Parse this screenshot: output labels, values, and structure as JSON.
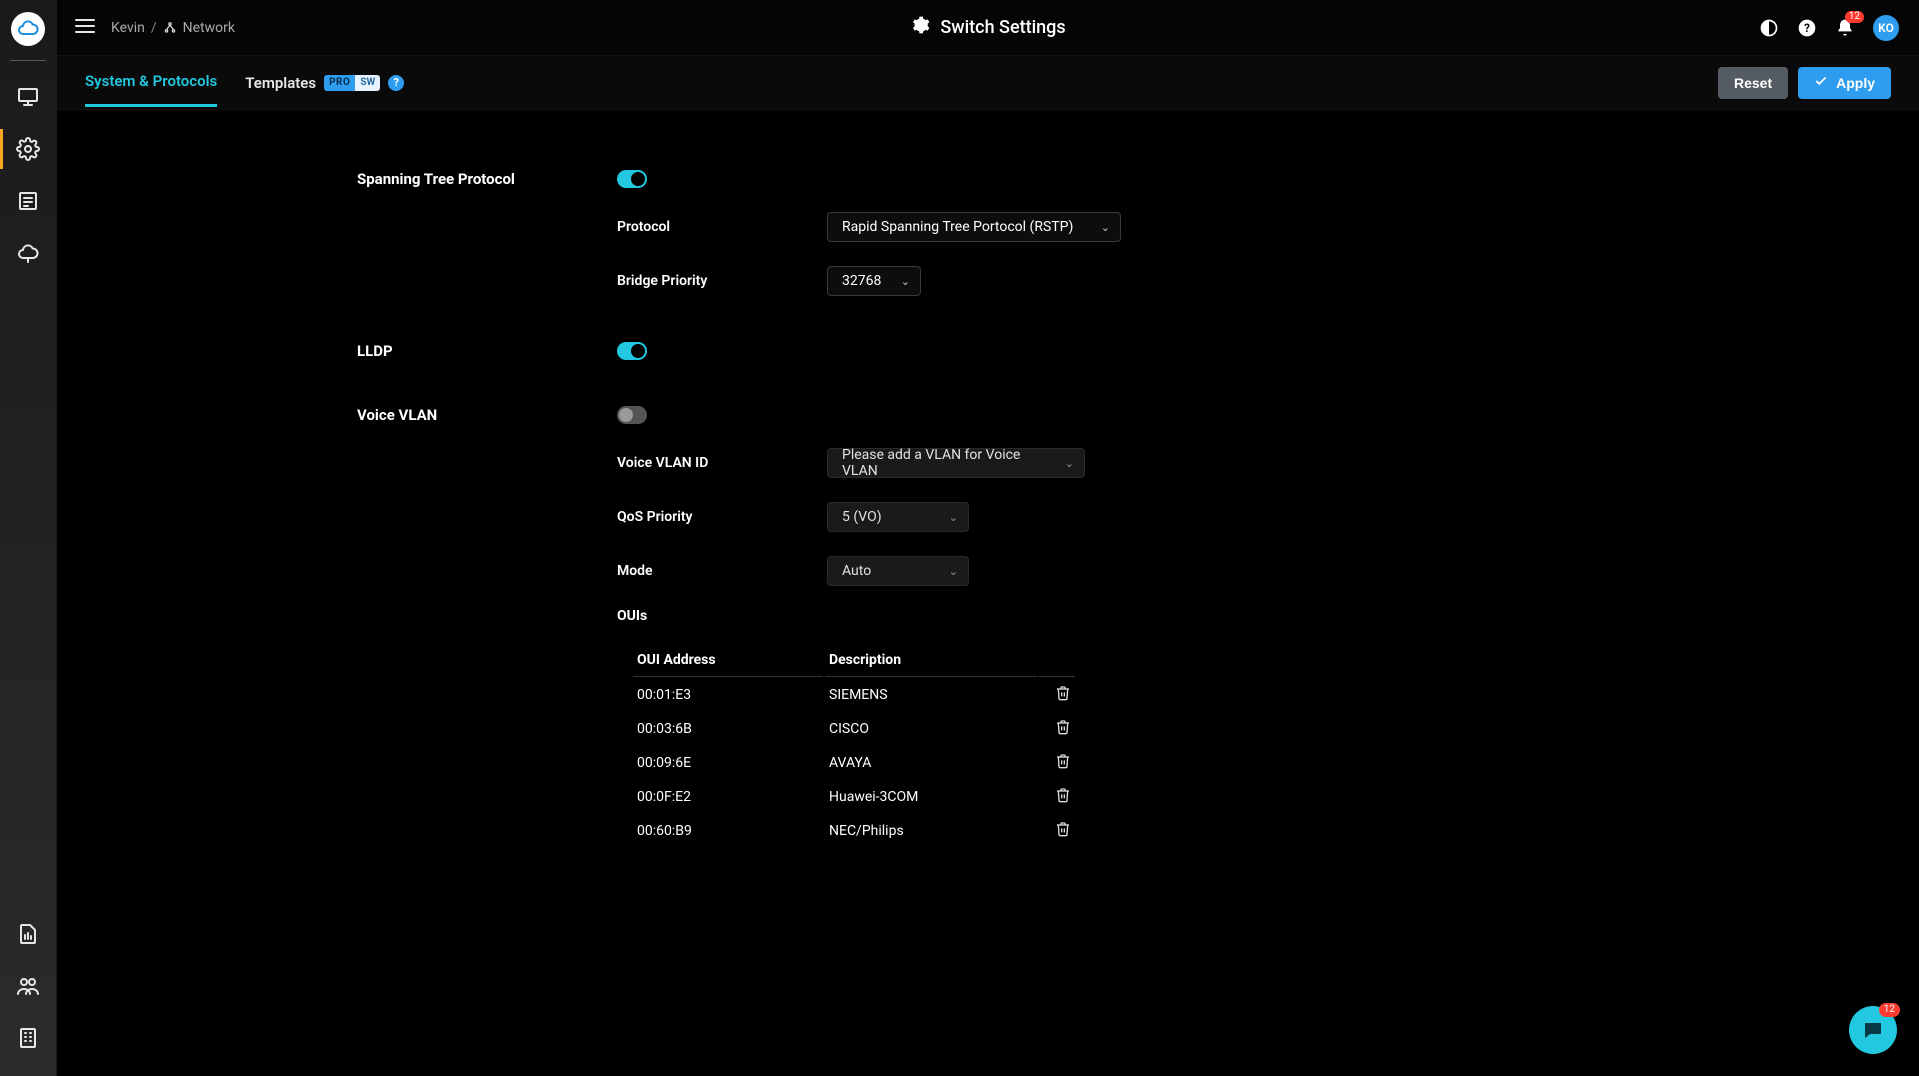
{
  "header": {
    "breadcrumb": {
      "user": "Kevin",
      "network_label": "Network"
    },
    "title": "Switch Settings",
    "avatar_initials": "KO",
    "bell_count": "12"
  },
  "tabs": {
    "active": "System & Protocols",
    "templates": "Templates",
    "chip_pro": "PRO",
    "chip_sw": "SW",
    "help_icon": "?"
  },
  "actions": {
    "reset": "Reset",
    "apply": "Apply"
  },
  "sections": {
    "stp": {
      "title": "Spanning Tree Protocol",
      "toggle": true,
      "protocol_label": "Protocol",
      "protocol_value": "Rapid Spanning Tree Portocol (RSTP)",
      "bridge_label": "Bridge Priority",
      "bridge_value": "32768"
    },
    "lldp": {
      "title": "LLDP",
      "toggle": true
    },
    "voice_vlan": {
      "title": "Voice VLAN",
      "toggle": false,
      "vlan_id_label": "Voice VLAN ID",
      "vlan_id_value": "Please add a VLAN for Voice VLAN",
      "qos_label": "QoS Priority",
      "qos_value": "5 (VO)",
      "mode_label": "Mode",
      "mode_value": "Auto",
      "ouis_label": "OUIs",
      "ouis_columns": {
        "addr": "OUI Address",
        "desc": "Description"
      },
      "ouis": [
        {
          "addr": "00:01:E3",
          "desc": "SIEMENS"
        },
        {
          "addr": "00:03:6B",
          "desc": "CISCO"
        },
        {
          "addr": "00:09:6E",
          "desc": "AVAYA"
        },
        {
          "addr": "00:0F:E2",
          "desc": "Huawei-3COM"
        },
        {
          "addr": "00:60:B9",
          "desc": "NEC/Philips"
        }
      ]
    }
  },
  "chat_badge": "12"
}
